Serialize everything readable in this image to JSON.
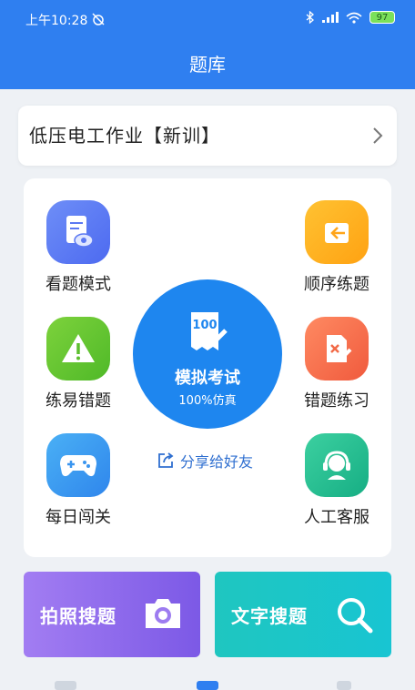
{
  "status": {
    "time": "上午10:28",
    "battery": "97"
  },
  "header": {
    "title": "题库"
  },
  "subject": {
    "label": "低压电工作业【新训】"
  },
  "features": {
    "view": "看题模式",
    "order": "顺序练题",
    "easy_wrong": "练易错题",
    "wrong_practice": "错题练习",
    "daily": "每日闯关",
    "service": "人工客服"
  },
  "exam": {
    "badge": "100",
    "title": "模拟考试",
    "subtitle": "100%仿真"
  },
  "share": {
    "label": "分享给好友"
  },
  "search": {
    "photo": "拍照搜题",
    "text": "文字搜题"
  },
  "colors": {
    "primary": "#2f7ff0",
    "exam": "#1e86ef",
    "photo": "#8b66ec",
    "text": "#1fc6c0"
  },
  "icons": [
    "alarm-off-icon",
    "bluetooth-icon",
    "signal-icon",
    "wifi-icon",
    "battery-icon",
    "chevron-right-icon",
    "eye-document-icon",
    "login-arrow-icon",
    "warning-icon",
    "edit-cross-icon",
    "gamepad-icon",
    "headset-icon",
    "exam-paper-icon",
    "share-icon",
    "camera-icon",
    "magnifier-icon"
  ]
}
